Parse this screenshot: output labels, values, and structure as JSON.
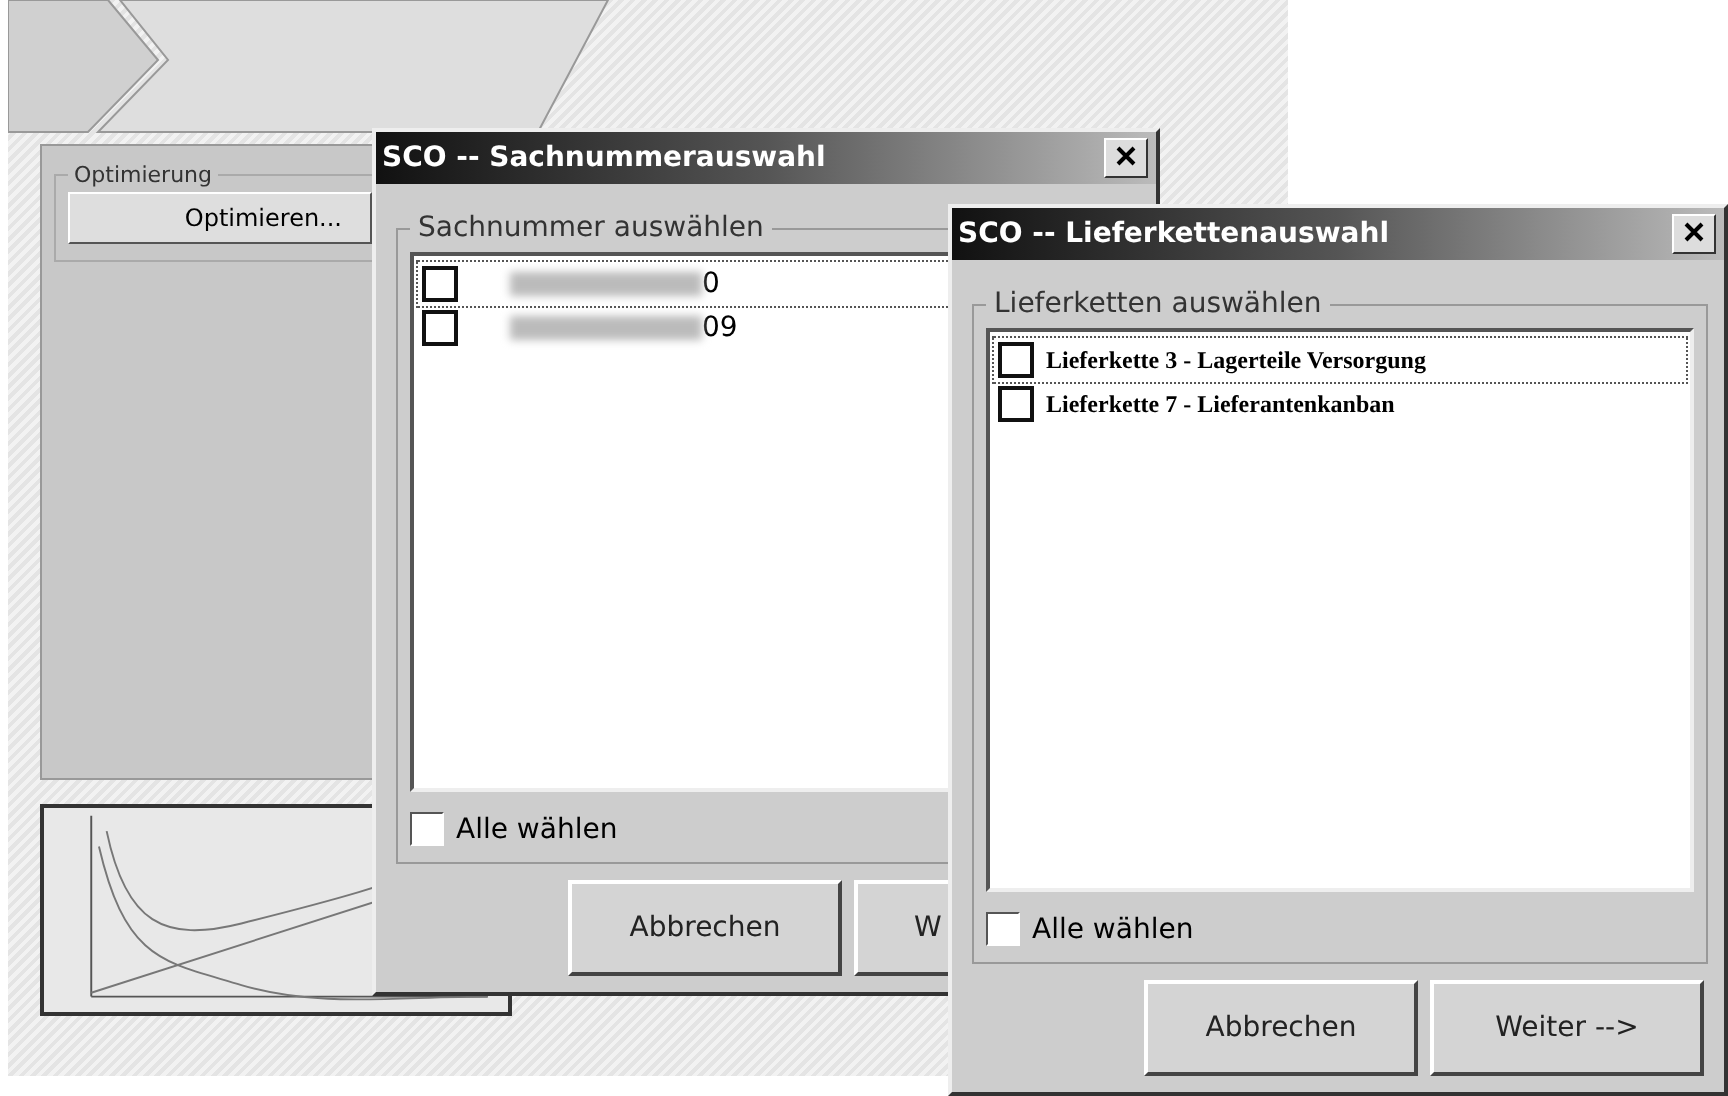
{
  "background_app": {
    "group_title": "Optimierung",
    "optimize_button": "Optimieren..."
  },
  "dialogs": [
    {
      "title": "SCO -- Sachnummerauswahl",
      "group_title": "Sachnummer auswählen",
      "items": [
        {
          "kind": "redacted",
          "label": "0",
          "checked": false,
          "focused": true
        },
        {
          "kind": "redacted",
          "label": "09",
          "checked": false,
          "focused": false
        }
      ],
      "select_all": {
        "label": "Alle wählen",
        "checked": false
      },
      "buttons": [
        "Abbrechen",
        "W"
      ]
    },
    {
      "title": "SCO -- Lieferkettenauswahl",
      "group_title": "Lieferketten auswählen",
      "items": [
        {
          "kind": "plain",
          "label": "Lieferkette 3 - Lagerteile Versorgung",
          "checked": false,
          "focused": true
        },
        {
          "kind": "plain",
          "label": "Lieferkette 7 - Lieferantenkanban",
          "checked": false,
          "focused": false
        }
      ],
      "select_all": {
        "label": "Alle wählen",
        "checked": false
      },
      "buttons": [
        "Abbrechen",
        "Weiter -->"
      ]
    }
  ]
}
